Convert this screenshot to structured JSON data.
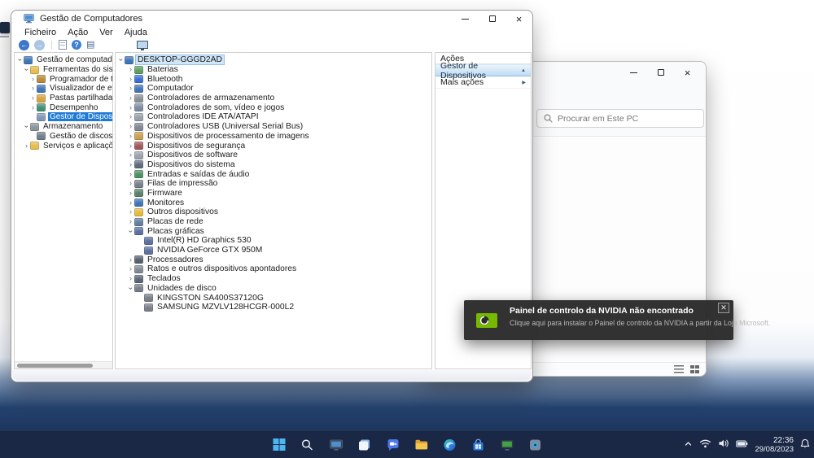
{
  "colors": {
    "accent": "#1f7ad4",
    "nvidia_green": "#76b900",
    "taskbar_bg": "#1a2846"
  },
  "window": {
    "title": "Gestão de Computadores",
    "menu_items": [
      "Ficheiro",
      "Ação",
      "Ver",
      "Ajuda"
    ]
  },
  "left_tree": {
    "items": [
      {
        "label": "Gestão de computadores (local)",
        "depth": 0,
        "state": "open",
        "icon": "computer-icon"
      },
      {
        "label": "Ferramentas do sistema",
        "depth": 1,
        "state": "open",
        "icon": "folder-icon"
      },
      {
        "label": "Programador de tarefas",
        "depth": 2,
        "state": "closed",
        "icon": "task-scheduler-icon"
      },
      {
        "label": "Visualizador de eventos",
        "depth": 2,
        "state": "closed",
        "icon": "event-viewer-icon"
      },
      {
        "label": "Pastas partilhadas",
        "depth": 2,
        "state": "closed",
        "icon": "shared-folders-icon"
      },
      {
        "label": "Desempenho",
        "depth": 2,
        "state": "closed",
        "icon": "performance-icon"
      },
      {
        "label": "Gestor de Dispositivos",
        "depth": 2,
        "state": "leaf",
        "icon": "device-manager-icon",
        "selected": true
      },
      {
        "label": "Armazenamento",
        "depth": 1,
        "state": "open",
        "icon": "storage-icon"
      },
      {
        "label": "Gestão de discos",
        "depth": 2,
        "state": "leaf",
        "icon": "disk-management-icon"
      },
      {
        "label": "Serviços e aplicações",
        "depth": 1,
        "state": "closed",
        "icon": "services-icon"
      }
    ]
  },
  "device_tree": {
    "items": [
      {
        "label": "DESKTOP-GGGD2AD",
        "depth": 0,
        "state": "open",
        "icon": "computer-icon",
        "selected": "inactive"
      },
      {
        "label": "Baterias",
        "depth": 1,
        "state": "closed",
        "icon": "battery-icon"
      },
      {
        "label": "Bluetooth",
        "depth": 1,
        "state": "closed",
        "icon": "bluetooth-icon"
      },
      {
        "label": "Computador",
        "depth": 1,
        "state": "closed",
        "icon": "computer-icon"
      },
      {
        "label": "Controladores de armazenamento",
        "depth": 1,
        "state": "closed",
        "icon": "storage-controller-icon"
      },
      {
        "label": "Controladores de som, vídeo e jogos",
        "depth": 1,
        "state": "closed",
        "icon": "sound-icon"
      },
      {
        "label": "Controladores IDE ATA/ATAPI",
        "depth": 1,
        "state": "closed",
        "icon": "ide-icon"
      },
      {
        "label": "Controladores USB (Universal Serial Bus)",
        "depth": 1,
        "state": "closed",
        "icon": "usb-icon"
      },
      {
        "label": "Dispositivos de processamento de imagens",
        "depth": 1,
        "state": "closed",
        "icon": "imaging-icon"
      },
      {
        "label": "Dispositivos de segurança",
        "depth": 1,
        "state": "closed",
        "icon": "security-icon"
      },
      {
        "label": "Dispositivos de software",
        "depth": 1,
        "state": "closed",
        "icon": "software-icon"
      },
      {
        "label": "Dispositivos do sistema",
        "depth": 1,
        "state": "closed",
        "icon": "system-devices-icon"
      },
      {
        "label": "Entradas e saídas de áudio",
        "depth": 1,
        "state": "closed",
        "icon": "audio-icon"
      },
      {
        "label": "Filas de impressão",
        "depth": 1,
        "state": "closed",
        "icon": "printer-icon"
      },
      {
        "label": "Firmware",
        "depth": 1,
        "state": "closed",
        "icon": "firmware-icon"
      },
      {
        "label": "Monitores",
        "depth": 1,
        "state": "closed",
        "icon": "monitor-icon"
      },
      {
        "label": "Outros dispositivos",
        "depth": 1,
        "state": "closed",
        "icon": "unknown-device-icon"
      },
      {
        "label": "Placas de rede",
        "depth": 1,
        "state": "closed",
        "icon": "network-icon"
      },
      {
        "label": "Placas gráficas",
        "depth": 1,
        "state": "open",
        "icon": "gpu-icon"
      },
      {
        "label": "Intel(R) HD Graphics 530",
        "depth": 2,
        "state": "leaf",
        "icon": "gpu-icon"
      },
      {
        "label": "NVIDIA GeForce GTX 950M",
        "depth": 2,
        "state": "leaf",
        "icon": "gpu-icon"
      },
      {
        "label": "Processadores",
        "depth": 1,
        "state": "closed",
        "icon": "cpu-icon"
      },
      {
        "label": "Ratos e outros dispositivos apontadores",
        "depth": 1,
        "state": "closed",
        "icon": "mouse-icon"
      },
      {
        "label": "Teclados",
        "depth": 1,
        "state": "closed",
        "icon": "keyboard-icon"
      },
      {
        "label": "Unidades de disco",
        "depth": 1,
        "state": "open",
        "icon": "disk-icon"
      },
      {
        "label": "KINGSTON SA400S37120G",
        "depth": 2,
        "state": "leaf",
        "icon": "disk-icon"
      },
      {
        "label": "SAMSUNG MZVLV128HCGR-000L2",
        "depth": 2,
        "state": "leaf",
        "icon": "disk-icon"
      }
    ]
  },
  "actions": {
    "title": "Ações",
    "group": "Gestor de Dispositivos",
    "more": "Mais ações"
  },
  "explorer": {
    "search_placeholder": "Procurar em Este PC"
  },
  "toast": {
    "title": "Painel de controlo da NVIDIA não encontrado",
    "message": "Clique aqui para instalar o Painel de controlo da NVIDIA a partir da Loja Microsoft."
  },
  "taskbar": {
    "time": "22:36",
    "date": "29/08/2023"
  }
}
